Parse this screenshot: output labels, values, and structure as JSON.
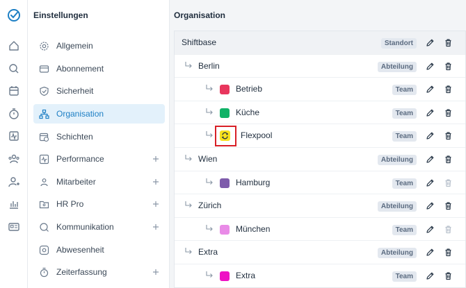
{
  "sidebar": {
    "title": "Einstellungen",
    "items": [
      {
        "label": "Allgemein"
      },
      {
        "label": "Abonnement"
      },
      {
        "label": "Sicherheit"
      },
      {
        "label": "Organisation"
      },
      {
        "label": "Schichten"
      },
      {
        "label": "Performance"
      },
      {
        "label": "Mitarbeiter"
      },
      {
        "label": "HR Pro"
      },
      {
        "label": "Kommunikation"
      },
      {
        "label": "Abwesenheit"
      },
      {
        "label": "Zeiterfassung"
      }
    ]
  },
  "main": {
    "title": "Organisation",
    "rows": [
      {
        "name": "Shiftbase",
        "badge": "Standort",
        "color": ""
      },
      {
        "name": "Berlin",
        "badge": "Abteilung",
        "color": ""
      },
      {
        "name": "Betrieb",
        "badge": "Team",
        "color": "#e8365d"
      },
      {
        "name": "Küche",
        "badge": "Team",
        "color": "#10b267"
      },
      {
        "name": "Flexpool",
        "badge": "Team",
        "color": "#f7e11e"
      },
      {
        "name": "Wien",
        "badge": "Abteilung",
        "color": ""
      },
      {
        "name": "Hamburg",
        "badge": "Team",
        "color": "#7e5bab"
      },
      {
        "name": "Zürich",
        "badge": "Abteilung",
        "color": ""
      },
      {
        "name": "München",
        "badge": "Team",
        "color": "#e98be7"
      },
      {
        "name": "Extra",
        "badge": "Abteilung",
        "color": ""
      },
      {
        "name": "Extra",
        "badge": "Team",
        "color": "#ee12c4"
      }
    ]
  },
  "colors": {
    "accent": "#1d7fc4",
    "highlight": "#d81f26"
  }
}
